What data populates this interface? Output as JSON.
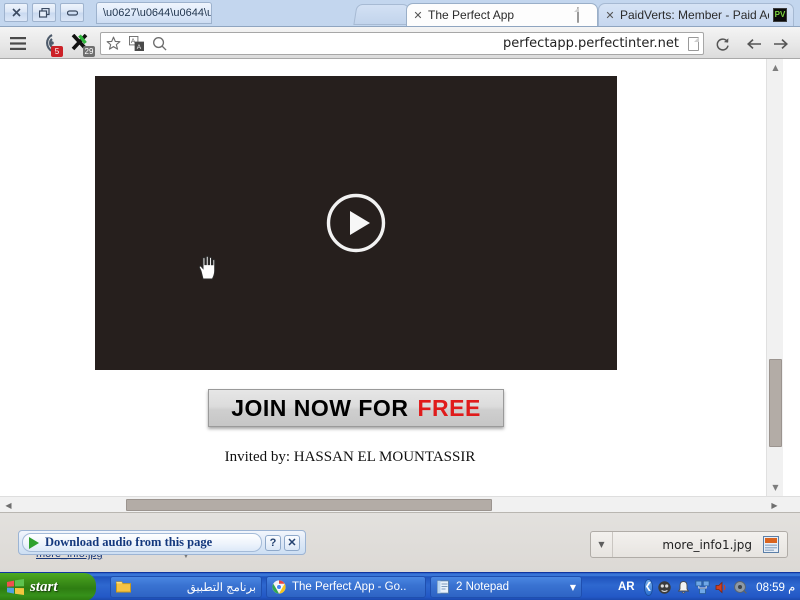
{
  "window": {
    "controls": {
      "close": "✕",
      "restore": "restore",
      "minimize": "minimize"
    },
    "taskbar_tab_title": "\\u0627\\u0644\\u0644\\u0644..."
  },
  "browser": {
    "tabs": [
      {
        "title": "The Perfect App",
        "close": "✕",
        "favicon": "blank-page-icon",
        "active": true
      },
      {
        "title": "PaidVerts: Member - Paid Ad",
        "close": "✕",
        "favicon": "PV",
        "active": false
      }
    ],
    "toolbar": {
      "menu_icon": "hamburger-menu-icon",
      "extension1_badge": "5",
      "extension2_badge": "29",
      "star_icon": "bookmark-star-icon",
      "translate_icon": "translate-icon",
      "search_icon": "search-icon",
      "reload": "↺",
      "back": "←",
      "forward": "→"
    },
    "omnibox": {
      "url": "perfectapp.perfectinter.net",
      "page_action_icon": "page-document-icon"
    }
  },
  "page": {
    "video": {
      "state": "paused",
      "play_icon": "play-button-icon"
    },
    "join_button": {
      "text": "JOIN NOW FOR",
      "highlight": "FREE",
      "highlight_color": "#e01b1b"
    },
    "invited_by": "Invited by: HASSAN EL MOUNTASSIR"
  },
  "download_shelf": {
    "hidden_item": "more_info.jpg",
    "audio_overlay": {
      "label": "Download audio from this page",
      "play_icon": "green-play-icon",
      "help_button": "?",
      "close_button": "✕"
    },
    "download_item": {
      "name": "more_info1.jpg",
      "caret": "▼",
      "file_icon": "jpg-file-icon"
    }
  },
  "taskbar": {
    "start_label": "start",
    "items": [
      {
        "label": "برنامج التطبيق",
        "icon": "folder-icon",
        "caret": ""
      },
      {
        "label": "The Perfect App - Go..",
        "icon": "chrome-icon",
        "caret": ""
      },
      {
        "label": "2 Notepad",
        "icon": "notepad-icon",
        "caret": "▼"
      }
    ],
    "tray": {
      "language": "AR",
      "expand": "❮",
      "icons": [
        "antivirus-icon",
        "bell-icon",
        "network-icon",
        "volume-icon",
        "sound-icon"
      ],
      "clock": "08:59 م"
    }
  },
  "scrollbars": {
    "vertical_up": "▲",
    "vertical_down": "▼",
    "horizontal_left": "◀",
    "horizontal_right": "▶"
  }
}
